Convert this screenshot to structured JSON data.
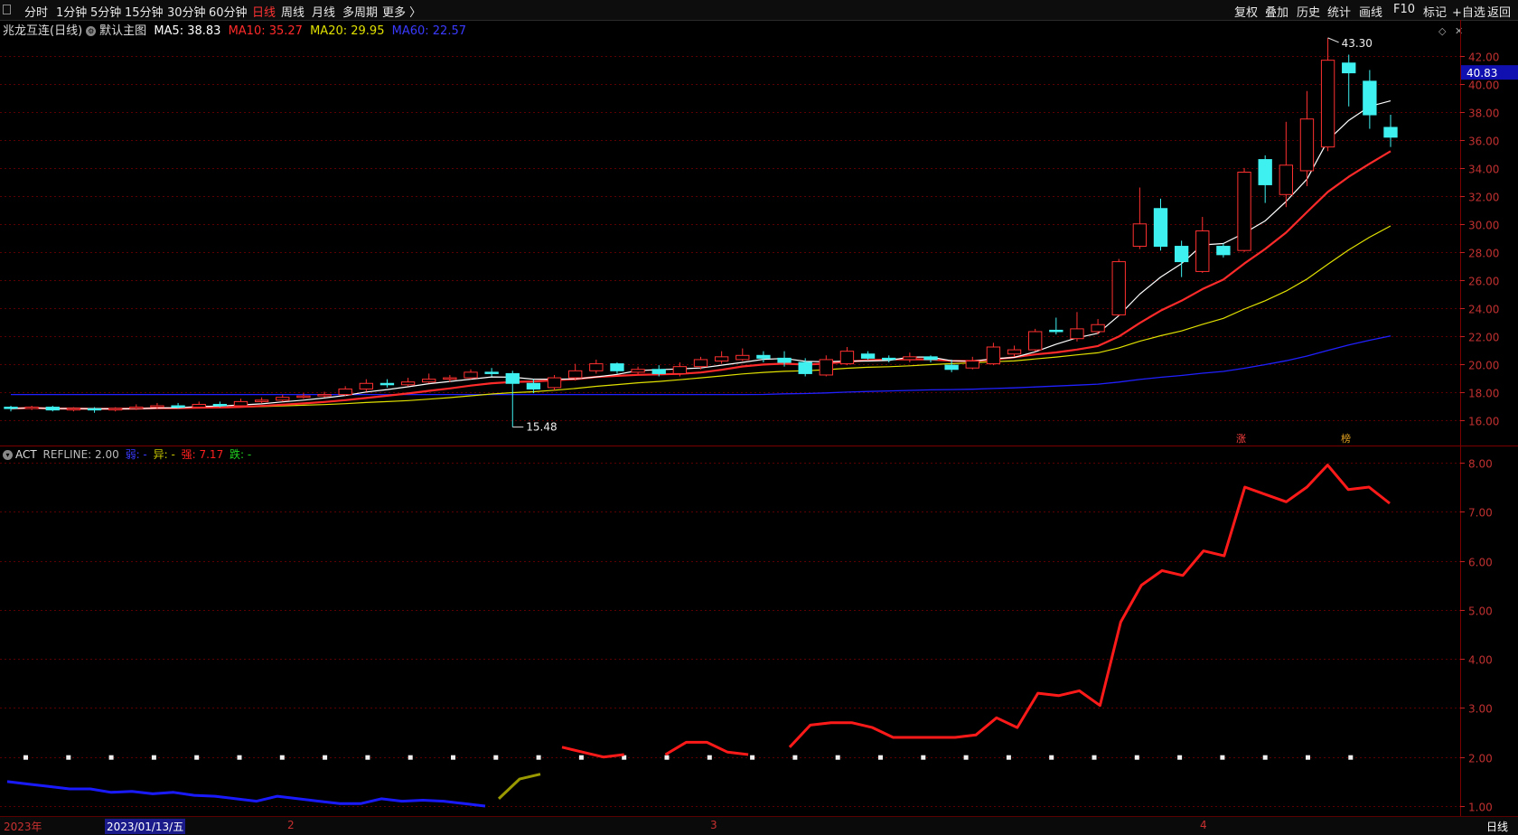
{
  "toolbar": {
    "left_items": [
      "分时",
      "1分钟",
      "5分钟",
      "15分钟",
      "30分钟",
      "60分钟",
      "日线",
      "周线",
      "月线",
      "多周期",
      "更多 〉"
    ],
    "active": "日线",
    "right_items": [
      "复权",
      "叠加",
      "历史",
      "统计",
      "画线",
      "F10",
      "标记",
      "+自选",
      "返回"
    ]
  },
  "legend": {
    "stock": "兆龙互连(日线)",
    "template": "默认主图",
    "ma5": "MA5: 38.83",
    "ma10": "MA10: 35.27",
    "ma20": "MA20: 29.95",
    "ma60": "MA60: 22.57",
    "colors": {
      "ma5": "#ffffff",
      "ma10": "#ff2a2a",
      "ma20": "#e0e000",
      "ma60": "#2020ff"
    }
  },
  "price_axis": {
    "ticks": [
      "42.00",
      "40.00",
      "38.00",
      "36.00",
      "34.00",
      "32.00",
      "30.00",
      "28.00",
      "26.00",
      "24.00",
      "22.00",
      "20.00",
      "18.00",
      "16.00"
    ],
    "current_price": "40.83",
    "high_label": "43.30",
    "low_label": "15.48",
    "marker_zhang": "涨",
    "marker_bang": "榜"
  },
  "act": {
    "name": "ACT",
    "refline": "REFLINE: 2.00",
    "items": [
      {
        "label": "弱: -",
        "color": "#3a3aff"
      },
      {
        "label": "异: -",
        "color": "#c8c800"
      },
      {
        "label": "强: 7.17",
        "color": "#ff2020"
      },
      {
        "label": "跌: -",
        "color": "#20d020"
      }
    ],
    "ticks": [
      "8.00",
      "7.00",
      "6.00",
      "5.00",
      "4.00",
      "3.00",
      "2.00",
      "1.00"
    ]
  },
  "bottom": {
    "year": "2023年",
    "selected_date": "2023/01/13/五",
    "months": [
      "2",
      "3",
      "4"
    ],
    "period": "日线"
  },
  "chart_data": [
    {
      "type": "candlestick",
      "title": "兆龙互连(日线)",
      "ylim": [
        15,
        43.5
      ],
      "candles": [
        [
          16.9,
          16.8,
          17.0,
          16.6
        ],
        [
          16.8,
          16.9,
          17.0,
          16.7
        ],
        [
          16.9,
          16.7,
          17.0,
          16.6
        ],
        [
          16.7,
          16.8,
          16.9,
          16.6
        ],
        [
          16.8,
          16.7,
          16.9,
          16.5
        ],
        [
          16.7,
          16.8,
          16.9,
          16.6
        ],
        [
          16.8,
          16.9,
          17.1,
          16.7
        ],
        [
          16.9,
          17.0,
          17.2,
          16.8
        ],
        [
          17.0,
          16.9,
          17.2,
          16.8
        ],
        [
          16.9,
          17.1,
          17.3,
          16.8
        ],
        [
          17.1,
          17.0,
          17.3,
          16.9
        ],
        [
          17.0,
          17.3,
          17.5,
          16.9
        ],
        [
          17.3,
          17.4,
          17.6,
          17.2
        ],
        [
          17.4,
          17.6,
          17.8,
          17.3
        ],
        [
          17.6,
          17.7,
          17.9,
          17.5
        ],
        [
          17.7,
          17.8,
          18.0,
          17.6
        ],
        [
          17.8,
          18.2,
          18.4,
          17.7
        ],
        [
          18.2,
          18.6,
          18.9,
          18.0
        ],
        [
          18.6,
          18.5,
          18.9,
          18.3
        ],
        [
          18.5,
          18.7,
          19.0,
          18.4
        ],
        [
          18.7,
          18.9,
          19.3,
          18.6
        ],
        [
          18.9,
          19.0,
          19.2,
          18.7
        ],
        [
          19.0,
          19.4,
          19.6,
          18.9
        ],
        [
          19.4,
          19.3,
          19.7,
          19.1
        ],
        [
          19.3,
          18.6,
          19.5,
          15.48
        ],
        [
          18.6,
          18.2,
          18.9,
          17.9
        ],
        [
          18.3,
          19.0,
          19.2,
          18.1
        ],
        [
          19.0,
          19.5,
          20.0,
          18.8
        ],
        [
          19.5,
          20.0,
          20.3,
          19.3
        ],
        [
          20.0,
          19.5,
          20.1,
          19.3
        ],
        [
          19.4,
          19.6,
          19.8,
          19.2
        ],
        [
          19.6,
          19.3,
          19.9,
          19.1
        ],
        [
          19.3,
          19.8,
          20.1,
          19.1
        ],
        [
          19.8,
          20.3,
          20.5,
          19.6
        ],
        [
          20.2,
          20.5,
          20.9,
          20.0
        ],
        [
          20.3,
          20.6,
          21.1,
          20.2
        ],
        [
          20.6,
          20.4,
          20.9,
          20.1
        ],
        [
          20.4,
          20.1,
          20.9,
          19.8
        ],
        [
          20.1,
          19.3,
          20.4,
          19.1
        ],
        [
          19.2,
          20.3,
          20.6,
          19.1
        ],
        [
          20.0,
          20.9,
          21.2,
          19.9
        ],
        [
          20.7,
          20.4,
          20.9,
          20.3
        ],
        [
          20.4,
          20.3,
          20.6,
          20.1
        ],
        [
          20.3,
          20.5,
          20.8,
          20.1
        ],
        [
          20.5,
          20.3,
          20.6,
          20.1
        ],
        [
          19.9,
          19.6,
          20.3,
          19.4
        ],
        [
          19.7,
          20.2,
          20.5,
          19.6
        ],
        [
          20.0,
          21.2,
          21.5,
          19.9
        ],
        [
          20.7,
          21.0,
          21.3,
          20.5
        ],
        [
          21.0,
          22.3,
          22.5,
          20.9
        ],
        [
          22.4,
          22.3,
          23.3,
          22.1
        ],
        [
          21.8,
          22.5,
          23.7,
          21.6
        ],
        [
          22.3,
          22.8,
          23.2,
          22.1
        ],
        [
          23.5,
          27.3,
          27.5,
          23.4
        ],
        [
          28.4,
          30.0,
          32.6,
          28.2
        ],
        [
          31.1,
          28.4,
          31.8,
          28.1
        ],
        [
          28.4,
          27.3,
          28.8,
          26.2
        ],
        [
          26.6,
          29.5,
          30.5,
          26.5
        ],
        [
          28.4,
          27.8,
          28.6,
          27.6
        ],
        [
          28.1,
          33.7,
          34.0,
          28.0
        ],
        [
          34.6,
          32.8,
          34.9,
          31.5
        ],
        [
          32.1,
          34.2,
          37.3,
          31.2
        ],
        [
          33.8,
          37.5,
          39.5,
          32.7
        ],
        [
          35.5,
          41.7,
          43.3,
          35.2
        ],
        [
          41.5,
          40.8,
          42.1,
          38.4
        ],
        [
          40.2,
          37.8,
          41.0,
          36.8
        ],
        [
          36.9,
          36.2,
          37.8,
          35.5
        ]
      ],
      "ma5_end": 38.83,
      "ma10_end": 35.27,
      "ma20_end": 29.95,
      "ma60_end": 22.57
    },
    {
      "type": "line",
      "title": "ACT",
      "ylim": [
        0.8,
        8.4
      ],
      "refline": 2.0,
      "series": [
        {
          "name": "弱",
          "color": "#1a1aff",
          "values": [
            1.5,
            1.45,
            1.4,
            1.35,
            1.35,
            1.28,
            1.3,
            1.25,
            1.28,
            1.22,
            1.2,
            1.15,
            1.1,
            1.2,
            1.15,
            1.1,
            1.05,
            1.05,
            1.15,
            1.1,
            1.12,
            1.1,
            1.05,
            1.0
          ]
        },
        {
          "name": "异",
          "color": "#9a9a00",
          "values": [
            1.15,
            1.55,
            1.65
          ]
        },
        {
          "name": "强",
          "color": "#ff1a1a",
          "values": [
            2.2,
            2.1,
            2.0,
            2.05,
            null,
            2.05,
            2.3,
            2.3,
            2.1,
            2.05,
            null,
            2.2,
            2.65,
            2.7,
            2.7,
            2.6,
            2.4,
            2.4,
            2.4,
            2.4,
            2.45,
            2.8,
            2.6,
            3.3,
            3.25,
            3.35,
            3.05,
            4.75,
            5.5,
            5.8,
            5.7,
            6.2,
            6.1,
            7.5,
            7.35,
            7.2,
            7.5,
            7.95,
            7.45,
            7.5,
            7.17
          ]
        }
      ]
    }
  ]
}
